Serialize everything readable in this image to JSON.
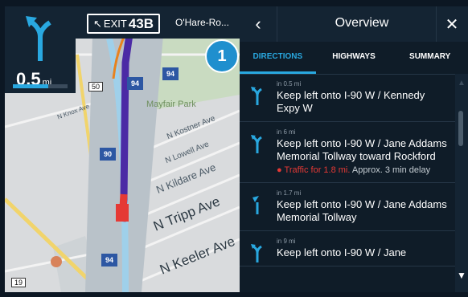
{
  "maneuver": {
    "distance": "0.5",
    "unit": "mi",
    "progress": 0.65
  },
  "exit_sign": {
    "arrow": "↖",
    "exit_label": "EXIT",
    "exit_number": "43B"
  },
  "towards": "O'Hare-Ro...",
  "panel": {
    "back_icon": "‹",
    "title": "Overview",
    "close_icon": "✕"
  },
  "tabs": [
    {
      "label": "DIRECTIONS",
      "active": true
    },
    {
      "label": "HIGHWAYS",
      "active": false
    },
    {
      "label": "SUMMARY",
      "active": false
    }
  ],
  "step_badge": "1",
  "directions": [
    {
      "distance": "in 0.5 mi",
      "text": "Keep left onto I-90 W / Kennedy Expy W"
    },
    {
      "distance": "in 6 mi",
      "text": "Keep left onto I-90 W / Jane Addams Memorial Tollway toward Rockford",
      "traffic": "Traffic for 1.8 mi.",
      "delay": "Approx. 3 min delay"
    },
    {
      "distance": "in 1.7 mi",
      "text": "Keep left onto I-90 W / Jane Addams Memorial Tollway"
    },
    {
      "distance": "in 9 mi",
      "text": "Keep left onto I-90 W / Jane"
    }
  ],
  "map": {
    "labels": {
      "park": "Mayfair Park",
      "knox": "N Knox Ave",
      "kostner": "N Kostner Ave",
      "lowell": "N Lowell Ave",
      "kildare": "N Kildare Ave",
      "tripp": "N Tripp Ave",
      "keeler": "N Keeler Ave"
    },
    "shields": {
      "s94a": "94",
      "s94b": "94",
      "s90": "90",
      "s94c": "94"
    },
    "routes": {
      "r50": "50",
      "r19": "19"
    }
  },
  "colors": {
    "accent": "#29a8e0",
    "route": "#4b2aa5",
    "traffic": "#e53935",
    "panel": "#0f1c28"
  }
}
